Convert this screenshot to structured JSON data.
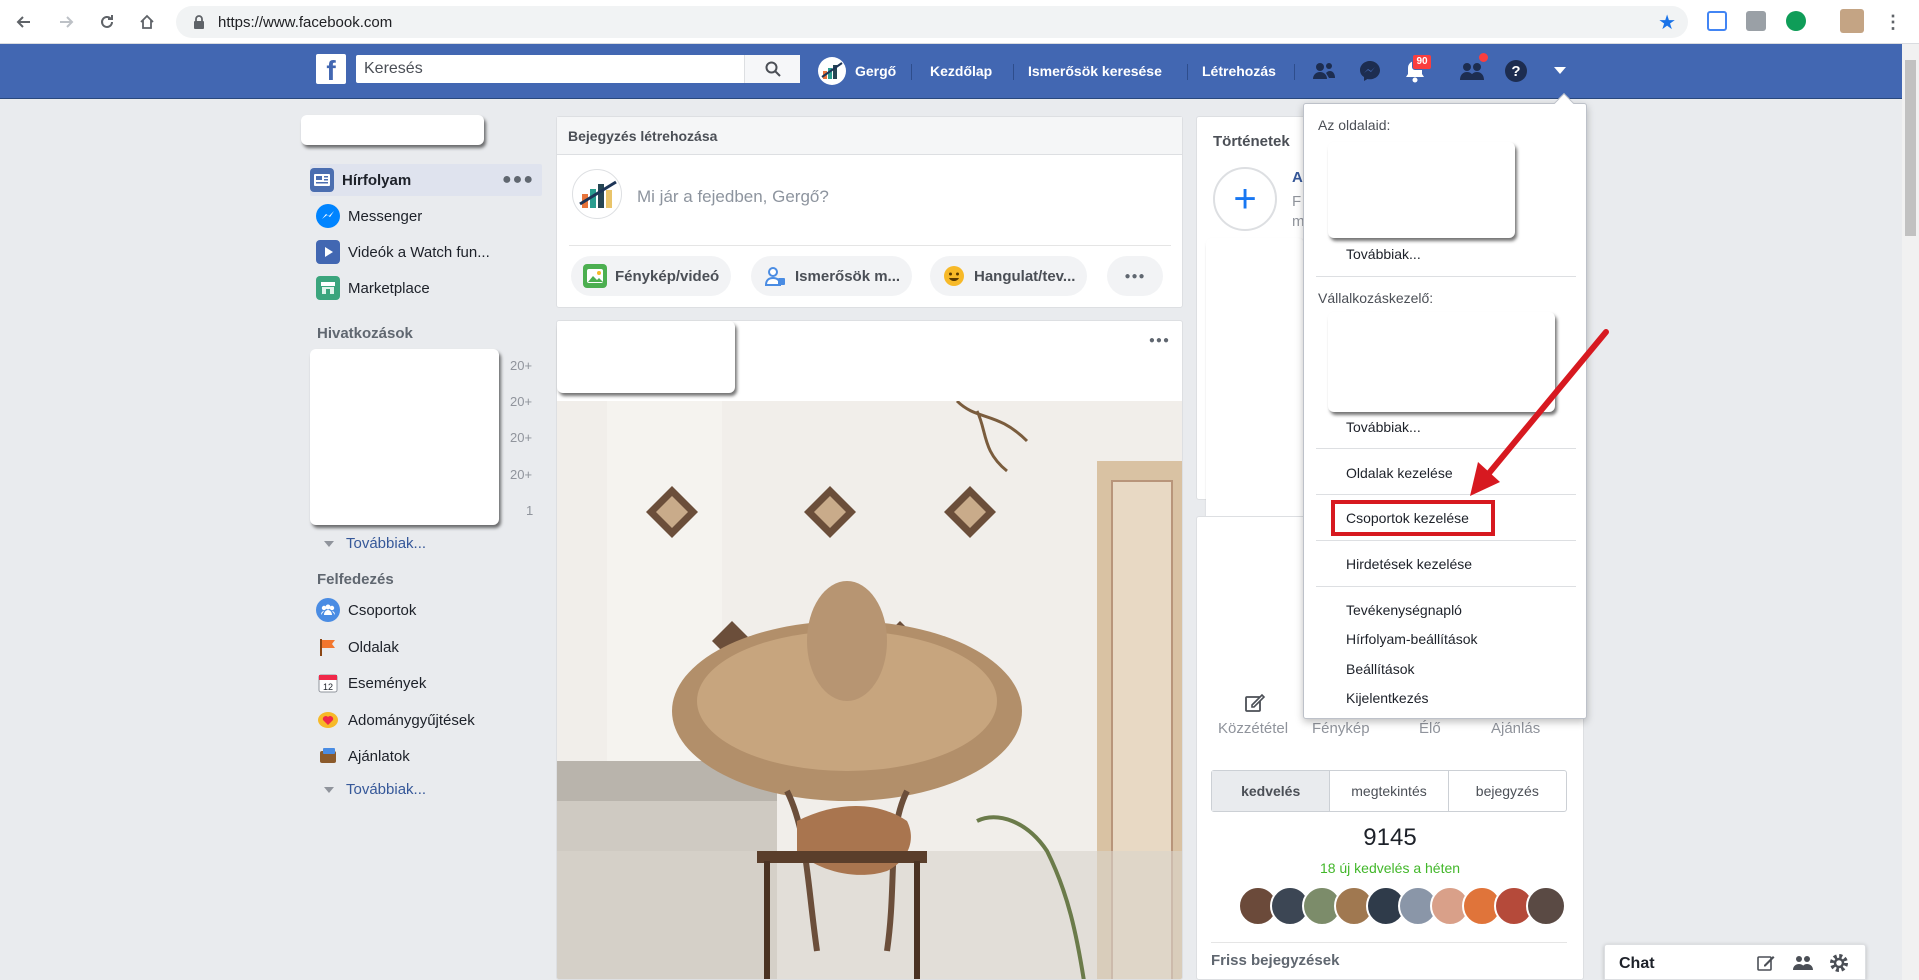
{
  "browser": {
    "url": "https://www.facebook.com"
  },
  "header": {
    "logo": "f",
    "search_placeholder": "Keresés",
    "user_name": "Gergő",
    "nav": [
      "Kezdőlap",
      "Ismerősök keresése",
      "Létrehozás"
    ],
    "notification_count": "90"
  },
  "left_sidebar": {
    "main_items": [
      "Hírfolyam",
      "Messenger",
      "Videók a Watch fun...",
      "Marketplace"
    ],
    "shortcuts_title": "Hivatkozások",
    "shortcut_counts": [
      "20+",
      "20+",
      "20+",
      "20+",
      "1"
    ],
    "shortcuts_more": "Továbbiak...",
    "explore_title": "Felfedezés",
    "explore_items": [
      "Csoportok",
      "Oldalak",
      "Események",
      "Adománygyűjtések",
      "Ajánlatok"
    ],
    "explore_more": "Továbbiak..."
  },
  "composer": {
    "title": "Bejegyzés létrehozása",
    "placeholder": "Mi jár a fejedben, Gergő?",
    "actions": [
      "Fénykép/videó",
      "Ismerősök m...",
      "Hangulat/tev..."
    ]
  },
  "stories": {
    "title": "Történetek",
    "partial_title": "A",
    "partial_lines": [
      "F",
      "m"
    ]
  },
  "page_panel": {
    "actions": [
      "Közzététel",
      "Fénykép",
      "Élő",
      "Ajánlás"
    ],
    "tabs": [
      "kedvelés",
      "megtekintés",
      "bejegyzés"
    ],
    "likes": "9145",
    "new_likes": "18 új kedvelés a héten",
    "recent_posts": "Friss bejegyzések"
  },
  "menu": {
    "your_pages": "Az oldalaid:",
    "more1": "Továbbiak...",
    "business_manager": "Vállalkozáskezelő:",
    "more2": "Továbbiak...",
    "manage_pages": "Oldalak kezelése",
    "manage_groups": "Csoportok kezelése",
    "manage_ads": "Hirdetések kezelése",
    "activity_log": "Tevékenységnapló",
    "news_feed_prefs": "Hírfolyam-beállítások",
    "settings": "Beállítások",
    "logout": "Kijelentkezés"
  },
  "chat": {
    "label": "Chat"
  },
  "colors": {
    "fb_blue": "#4267b2",
    "highlight_red": "#d71920",
    "link_blue": "#365899",
    "green": "#42b72a"
  }
}
